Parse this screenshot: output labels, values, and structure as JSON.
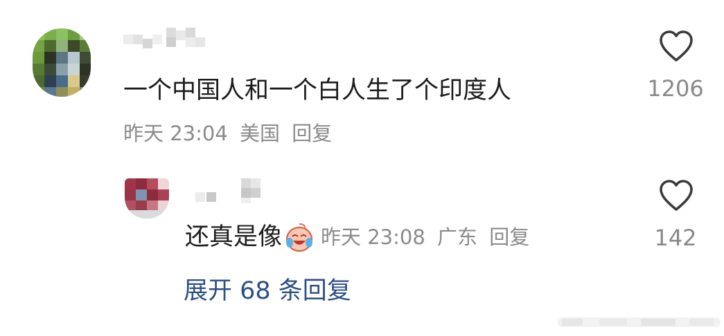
{
  "comment": {
    "text": "一个中国人和一个白人生了个印度人",
    "time": "昨天 23:04",
    "location": "美国",
    "reply_label": "回复",
    "like_count": "1206",
    "like_icon": "heart-outline-icon"
  },
  "reply": {
    "text": "还真是像",
    "emoji": "crying-laughing-emoji",
    "time": "昨天 23:08",
    "location": "广东",
    "reply_label": "回复",
    "like_count": "142",
    "like_icon": "heart-outline-icon"
  },
  "expand_label": "展开 68 条回复",
  "colors": {
    "text": "#1c1c1c",
    "meta": "#8a8a8a",
    "link": "#2b4f86",
    "icon": "#3a3a3a"
  }
}
